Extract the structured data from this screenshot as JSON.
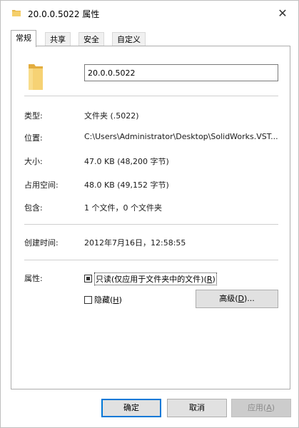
{
  "window": {
    "title": "20.0.0.5022 属性",
    "close_label": "✕"
  },
  "tabs": [
    {
      "label": "常规"
    },
    {
      "label": "共享"
    },
    {
      "label": "安全"
    },
    {
      "label": "自定义"
    }
  ],
  "general": {
    "name_value": "20.0.0.5022",
    "rows": [
      {
        "label": "类型:",
        "value": "文件夹 (.5022)"
      },
      {
        "label": "位置:",
        "value": "C:\\Users\\Administrator\\Desktop\\SolidWorks.VST..."
      },
      {
        "label": "大小:",
        "value": "47.0 KB (48,200 字节)"
      },
      {
        "label": "占用空间:",
        "value": "48.0 KB (49,152 字节)"
      },
      {
        "label": "包含:",
        "value": "1 个文件，0 个文件夹"
      },
      {
        "label": "创建时间:",
        "value": "2012年7月16日，12:58:55"
      }
    ],
    "attributes_label": "属性:",
    "readonly_label": "只读(仅应用于文件夹中的文件)(",
    "readonly_key": "R",
    "readonly_end": ")",
    "hidden_label": "隐藏(",
    "hidden_key": "H",
    "hidden_end": ")",
    "advanced_label": "高级(",
    "advanced_key": "D",
    "advanced_end": ")..."
  },
  "buttons": {
    "ok": "确定",
    "cancel": "取消",
    "apply_label": "应用(",
    "apply_key": "A",
    "apply_end": ")"
  },
  "colors": {
    "folder": "#f0c45a",
    "focus": "#0078d7"
  },
  "icons": {
    "title": "folder-icon",
    "big": "folder-icon"
  }
}
